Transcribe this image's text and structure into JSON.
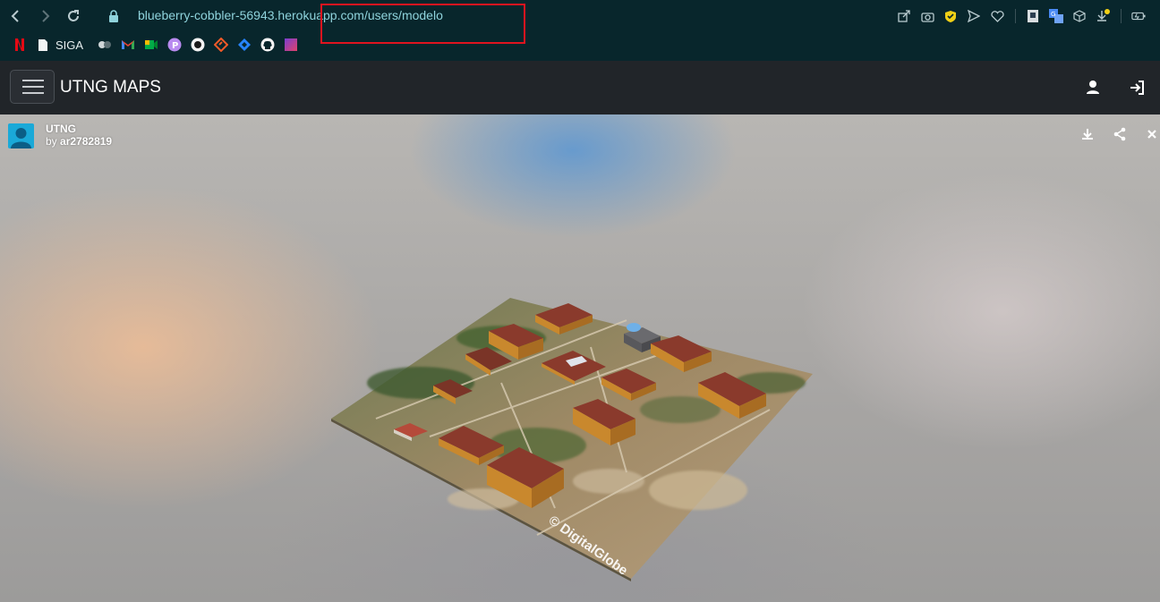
{
  "browser": {
    "url_domain": "blueberry-cobbler-56943.herokuapp.com",
    "url_path": "/users/modelo",
    "bookmarks": [
      {
        "icon": "netflix-icon",
        "label": ""
      },
      {
        "icon": "document-icon",
        "label": "SIGA"
      },
      {
        "icon": "tiktok-like-icon",
        "label": ""
      },
      {
        "icon": "gmail-icon",
        "label": ""
      },
      {
        "icon": "meet-icon",
        "label": ""
      },
      {
        "icon": "purple-p-icon",
        "label": ""
      },
      {
        "icon": "dark-circle-icon",
        "label": ""
      },
      {
        "icon": "orange-diamond-icon",
        "label": ""
      },
      {
        "icon": "jira-icon",
        "label": ""
      },
      {
        "icon": "github-icon",
        "label": ""
      },
      {
        "icon": "gradient-square-icon",
        "label": ""
      }
    ],
    "extensions": [
      "share-icon",
      "camera-icon",
      "shield-icon",
      "send-icon",
      "heart-icon",
      "ext-box-icon",
      "translate-icon",
      "cube-icon",
      "download-icon",
      "battery-icon"
    ]
  },
  "navbar": {
    "brand": "UTNG MAPS"
  },
  "viewer": {
    "model_title": "UTNG",
    "author_prefix": "by",
    "author": "ar2782819",
    "watermark": "© DigitalGlobe"
  },
  "colors": {
    "chrome_bg": "#08262c",
    "navbar_bg": "#212529",
    "highlight": "#e0141f",
    "roof": "#8a3a2c",
    "wall": "#c9882d"
  }
}
